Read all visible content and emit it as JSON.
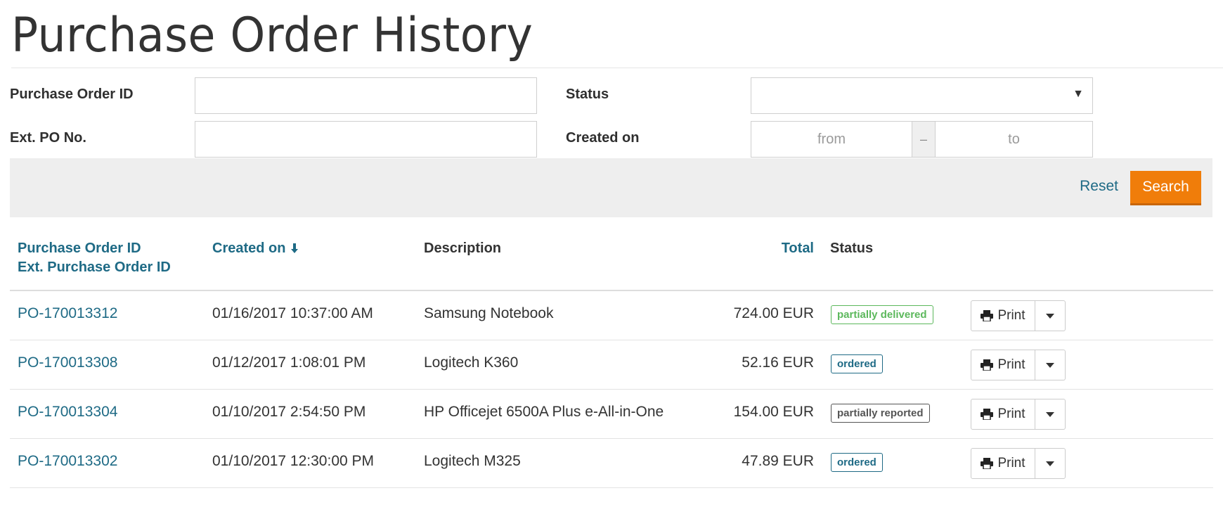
{
  "page": {
    "title": "Purchase Order History"
  },
  "filters": {
    "po_id_label": "Purchase Order ID",
    "po_id_value": "",
    "status_label": "Status",
    "status_value": "",
    "ext_po_label": "Ext. PO No.",
    "ext_po_value": "",
    "created_label": "Created on",
    "date_from_placeholder": "from",
    "date_separator": "–",
    "date_to_placeholder": "to"
  },
  "actions": {
    "reset_label": "Reset",
    "search_label": "Search"
  },
  "table": {
    "headers": {
      "po_id": "Purchase Order ID",
      "ext_po_id": "Ext. Purchase Order ID",
      "created": "Created on",
      "description": "Description",
      "total": "Total",
      "status": "Status"
    },
    "print_label": "Print",
    "rows": [
      {
        "po_id": "PO-170013312",
        "created": "01/16/2017 10:37:00 AM",
        "description": "Samsung Notebook",
        "total": "724.00 EUR",
        "status": "partially delivered",
        "status_color": "#5cb85c"
      },
      {
        "po_id": "PO-170013308",
        "created": "01/12/2017 1:08:01 PM",
        "description": "Logitech K360",
        "total": "52.16 EUR",
        "status": "ordered",
        "status_color": "#1e6a85"
      },
      {
        "po_id": "PO-170013304",
        "created": "01/10/2017 2:54:50 PM",
        "description": "HP Officejet 6500A Plus e-All-in-One",
        "total": "154.00 EUR",
        "status": "partially reported",
        "status_color": "#555555"
      },
      {
        "po_id": "PO-170013302",
        "created": "01/10/2017 12:30:00 PM",
        "description": "Logitech M325",
        "total": "47.89 EUR",
        "status": "ordered",
        "status_color": "#1e6a85"
      }
    ]
  },
  "colors": {
    "accent": "#1e6a85",
    "search_button": "#f07d0a"
  }
}
